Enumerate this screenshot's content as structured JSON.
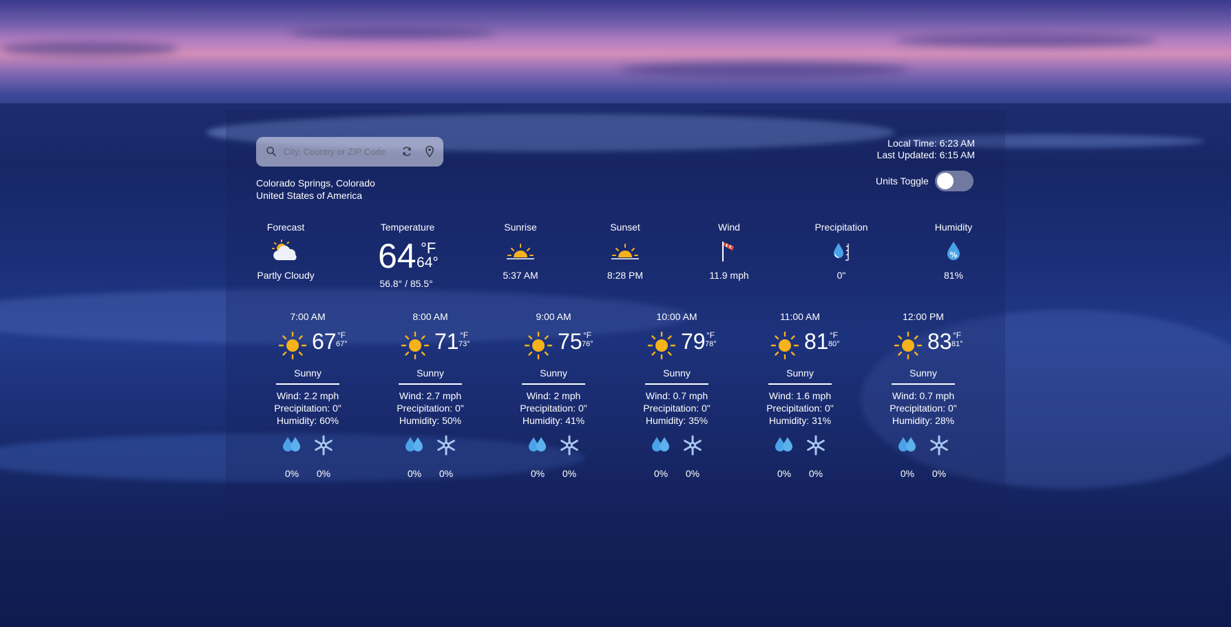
{
  "search": {
    "placeholder": "City, Country or ZIP Code"
  },
  "location": {
    "line1": "Colorado Springs, Colorado",
    "line2": "United States of America"
  },
  "meta": {
    "local_time": "Local Time: 6:23 AM",
    "last_updated": "Last Updated: 6:15 AM"
  },
  "units_toggle": {
    "label": "Units Toggle",
    "on": false
  },
  "summary": {
    "forecast": {
      "label": "Forecast",
      "value": "Partly Cloudy",
      "icon": "partly-cloudy-icon"
    },
    "temperature": {
      "label": "Temperature",
      "current": "64",
      "unit": "°F",
      "feels_like": "64°",
      "range": "56.8° / 85.5°"
    },
    "sunrise": {
      "label": "Sunrise",
      "value": "5:37 AM",
      "icon": "sunrise-icon"
    },
    "sunset": {
      "label": "Sunset",
      "value": "8:28 PM",
      "icon": "sunset-icon"
    },
    "wind": {
      "label": "Wind",
      "value": "11.9 mph",
      "icon": "windsock-icon"
    },
    "precipitation": {
      "label": "Precipitation",
      "value": "0\"",
      "icon": "rain-gauge-icon"
    },
    "humidity": {
      "label": "Humidity",
      "value": "81%",
      "icon": "humidity-drop-icon"
    }
  },
  "hourly": [
    {
      "time": "7:00 AM",
      "temp": "67",
      "unit": "°F",
      "feels": "67°",
      "condition": "Sunny",
      "wind": "Wind: 2.2 mph",
      "precip": "Precipitation: 0\"",
      "humidity": "Humidity: 60%",
      "rain_chance": "0%",
      "snow_chance": "0%"
    },
    {
      "time": "8:00 AM",
      "temp": "71",
      "unit": "°F",
      "feels": "73°",
      "condition": "Sunny",
      "wind": "Wind: 2.7 mph",
      "precip": "Precipitation: 0\"",
      "humidity": "Humidity: 50%",
      "rain_chance": "0%",
      "snow_chance": "0%"
    },
    {
      "time": "9:00 AM",
      "temp": "75",
      "unit": "°F",
      "feels": "76°",
      "condition": "Sunny",
      "wind": "Wind: 2 mph",
      "precip": "Precipitation: 0\"",
      "humidity": "Humidity: 41%",
      "rain_chance": "0%",
      "snow_chance": "0%"
    },
    {
      "time": "10:00 AM",
      "temp": "79",
      "unit": "°F",
      "feels": "78°",
      "condition": "Sunny",
      "wind": "Wind: 0.7 mph",
      "precip": "Precipitation: 0\"",
      "humidity": "Humidity: 35%",
      "rain_chance": "0%",
      "snow_chance": "0%"
    },
    {
      "time": "11:00 AM",
      "temp": "81",
      "unit": "°F",
      "feels": "80°",
      "condition": "Sunny",
      "wind": "Wind: 1.6 mph",
      "precip": "Precipitation: 0\"",
      "humidity": "Humidity: 31%",
      "rain_chance": "0%",
      "snow_chance": "0%"
    },
    {
      "time": "12:00 PM",
      "temp": "83",
      "unit": "°F",
      "feels": "81°",
      "condition": "Sunny",
      "wind": "Wind: 0.7 mph",
      "precip": "Precipitation: 0\"",
      "humidity": "Humidity: 28%",
      "rain_chance": "0%",
      "snow_chance": "0%"
    }
  ],
  "colors": {
    "sun": "#f6b21b",
    "drop": "#4aa3e8",
    "snowflake": "#a9c8ee",
    "windsock": "#e5533f"
  }
}
